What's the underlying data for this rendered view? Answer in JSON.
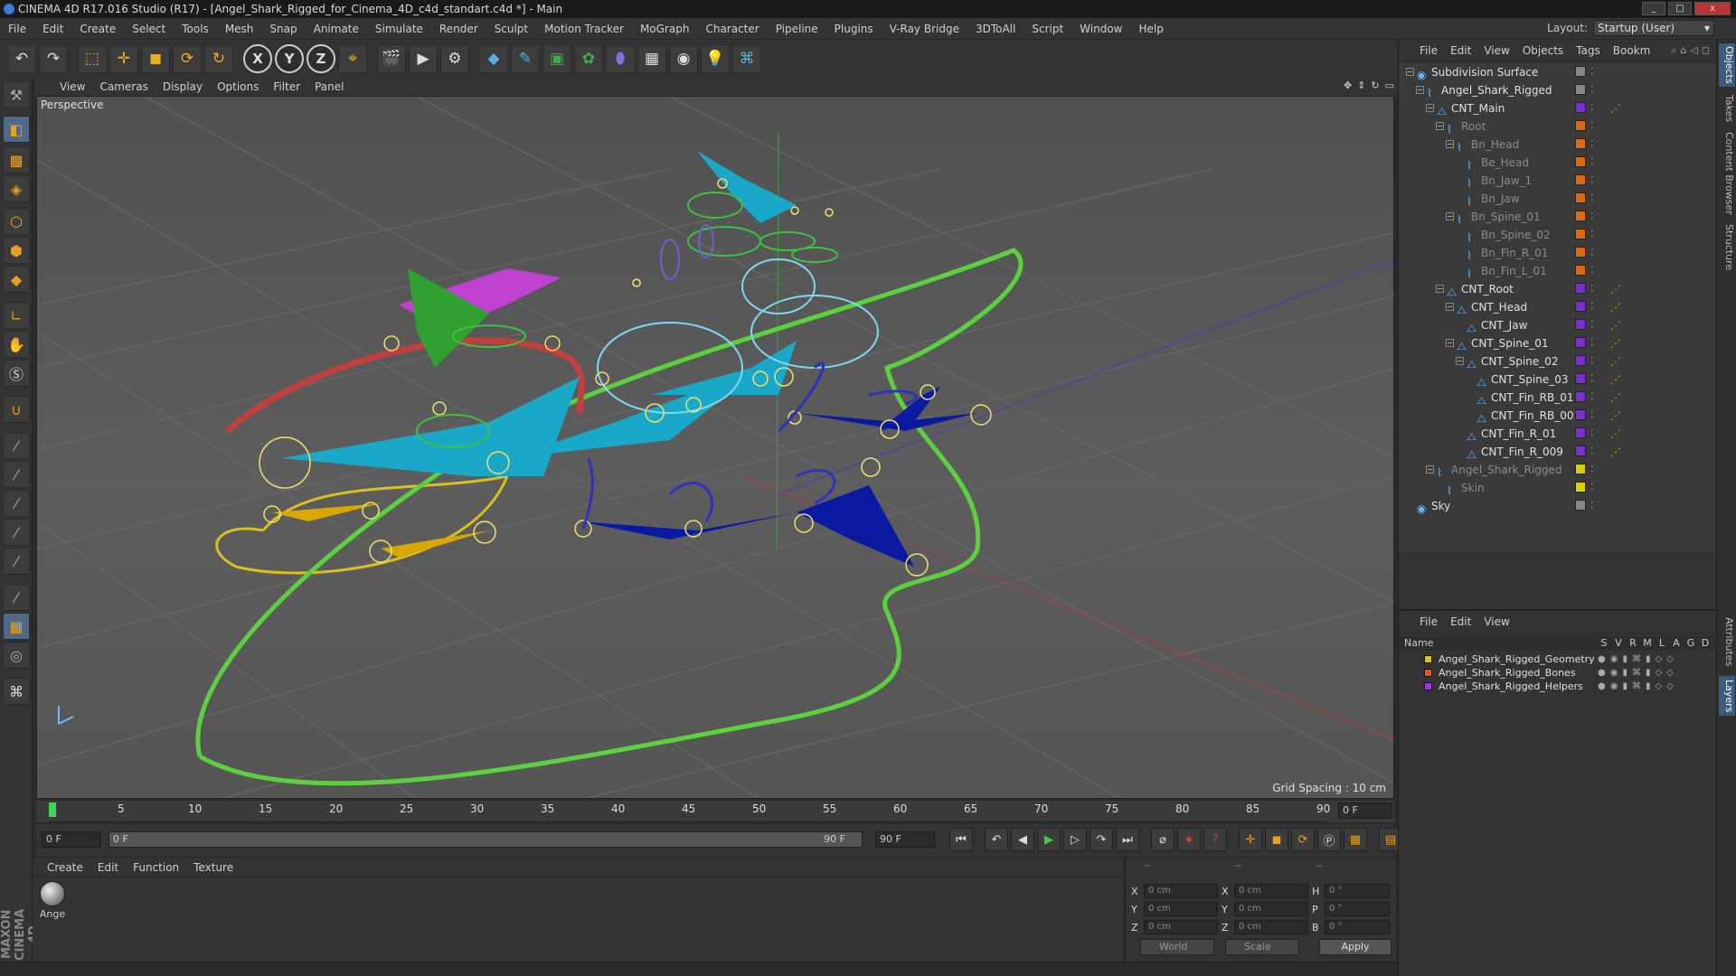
{
  "window": {
    "title": "CINEMA 4D R17.016 Studio (R17) - [Angel_Shark_Rigged_for_Cinema_4D_c4d_standart.c4d *] - Main",
    "controls": [
      "_",
      "□",
      "x"
    ]
  },
  "menubar": {
    "items": [
      "File",
      "Edit",
      "Create",
      "Select",
      "Tools",
      "Mesh",
      "Snap",
      "Animate",
      "Simulate",
      "Render",
      "Sculpt",
      "Motion Tracker",
      "MoGraph",
      "Character",
      "Pipeline",
      "Plugins",
      "V-Ray Bridge",
      "3DToAll",
      "Script",
      "Window",
      "Help"
    ],
    "layout_label": "Layout:",
    "layout_value": "Startup (User)"
  },
  "toolbar": {
    "axis_x": "X",
    "axis_y": "Y",
    "axis_z": "Z"
  },
  "viewport": {
    "menu": [
      "View",
      "Cameras",
      "Display",
      "Options",
      "Filter",
      "Panel"
    ],
    "camera_label": "Perspective",
    "grid_spacing": "Grid Spacing : 10 cm"
  },
  "timeline": {
    "ticks": [
      "0",
      "5",
      "10",
      "15",
      "20",
      "25",
      "30",
      "35",
      "40",
      "45",
      "50",
      "55",
      "60",
      "65",
      "70",
      "75",
      "80",
      "85",
      "90"
    ],
    "end_field": "0 F"
  },
  "transport": {
    "current_frame": "0 F",
    "slider_start": "0 F",
    "slider_end": "90 F",
    "max_frame": "90 F"
  },
  "material_manager": {
    "menu": [
      "Create",
      "Edit",
      "Function",
      "Texture"
    ],
    "materials": [
      {
        "name": "Ange"
      }
    ]
  },
  "coordinates": {
    "header_left": "--",
    "header_mid": "--",
    "header_right": "--",
    "rows": [
      {
        "l1": "X",
        "v1": "0 cm",
        "l2": "X",
        "v2": "0 cm",
        "l3": "H",
        "v3": "0 °"
      },
      {
        "l1": "Y",
        "v1": "0 cm",
        "l2": "Y",
        "v2": "0 cm",
        "l3": "P",
        "v3": "0 °"
      },
      {
        "l1": "Z",
        "v1": "0 cm",
        "l2": "Z",
        "v2": "0 cm",
        "l3": "B",
        "v3": "0 °"
      }
    ],
    "mode_dropdown": "World",
    "scale_dropdown": "Scale",
    "apply_label": "Apply"
  },
  "object_manager": {
    "menu": [
      "File",
      "Edit",
      "View",
      "Objects",
      "Tags",
      "Bookm"
    ],
    "objects": [
      {
        "name": "Subdivision Surface",
        "depth": 0,
        "dim": false,
        "color": "#888888"
      },
      {
        "name": "Angel_Shark_Rigged",
        "depth": 1,
        "dim": false,
        "color": "#888888"
      },
      {
        "name": "CNT_Main",
        "depth": 2,
        "dim": false,
        "color": "#7a2fd0"
      },
      {
        "name": "Root",
        "depth": 3,
        "dim": true,
        "color": "#e06a10"
      },
      {
        "name": "Bn_Head",
        "depth": 4,
        "dim": true,
        "color": "#e06a10"
      },
      {
        "name": "Be_Head",
        "depth": 5,
        "dim": true,
        "color": "#e06a10"
      },
      {
        "name": "Bn_Jaw_1",
        "depth": 5,
        "dim": true,
        "color": "#e06a10"
      },
      {
        "name": "Bn_Jaw",
        "depth": 5,
        "dim": true,
        "color": "#e06a10"
      },
      {
        "name": "Bn_Spine_01",
        "depth": 4,
        "dim": true,
        "color": "#e06a10"
      },
      {
        "name": "Bn_Spine_02",
        "depth": 5,
        "dim": true,
        "color": "#e06a10"
      },
      {
        "name": "Bn_Fin_R_01",
        "depth": 5,
        "dim": true,
        "color": "#e06a10"
      },
      {
        "name": "Bn_Fin_L_01",
        "depth": 5,
        "dim": true,
        "color": "#e06a10"
      },
      {
        "name": "CNT_Root",
        "depth": 3,
        "dim": false,
        "color": "#7a2fd0"
      },
      {
        "name": "CNT_Head",
        "depth": 4,
        "dim": false,
        "color": "#7a2fd0"
      },
      {
        "name": "CNT_Jaw",
        "depth": 5,
        "dim": false,
        "color": "#7a2fd0"
      },
      {
        "name": "CNT_Spine_01",
        "depth": 4,
        "dim": false,
        "color": "#7a2fd0"
      },
      {
        "name": "CNT_Spine_02",
        "depth": 5,
        "dim": false,
        "color": "#7a2fd0"
      },
      {
        "name": "CNT_Spine_03",
        "depth": 6,
        "dim": false,
        "color": "#7a2fd0"
      },
      {
        "name": "CNT_Fin_RB_01",
        "depth": 6,
        "dim": false,
        "color": "#7a2fd0"
      },
      {
        "name": "CNT_Fin_RB_005",
        "depth": 6,
        "dim": false,
        "color": "#7a2fd0"
      },
      {
        "name": "CNT_Fin_R_01",
        "depth": 5,
        "dim": false,
        "color": "#7a2fd0"
      },
      {
        "name": "CNT_Fin_R_009",
        "depth": 5,
        "dim": false,
        "color": "#7a2fd0"
      },
      {
        "name": "Angel_Shark_Rigged",
        "depth": 2,
        "dim": true,
        "color": "#d8d000"
      },
      {
        "name": "Skin",
        "depth": 3,
        "dim": true,
        "color": "#d8d000"
      },
      {
        "name": "Sky",
        "depth": 0,
        "dim": false,
        "color": "#888888"
      }
    ]
  },
  "layer_manager": {
    "menu": [
      "File",
      "Edit",
      "View"
    ],
    "columns": [
      "Name",
      "S",
      "V",
      "R",
      "M",
      "L",
      "A",
      "G",
      "D"
    ],
    "layers": [
      {
        "name": "Angel_Shark_Rigged_Geometry",
        "color": "#e0c020"
      },
      {
        "name": "Angel_Shark_Rigged_Bones",
        "color": "#e05a20"
      },
      {
        "name": "Angel_Shark_Rigged_Helpers",
        "color": "#9a3ad0"
      }
    ]
  },
  "side_tabs": [
    "Objects",
    "Takes",
    "Content Browser",
    "Structure",
    "Attributes",
    "Layers"
  ],
  "maxon_logo": "MAXON CINEMA 4D"
}
